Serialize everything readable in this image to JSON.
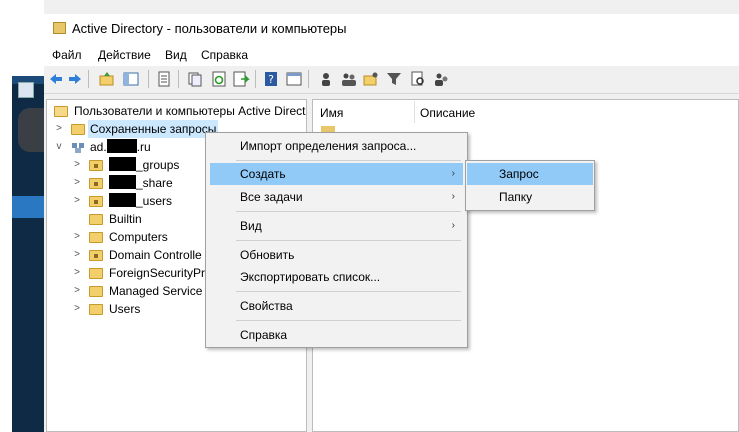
{
  "window": {
    "title": "Active Directory - пользователи и компьютеры",
    "menu": [
      "Файл",
      "Действие",
      "Вид",
      "Справка"
    ]
  },
  "toolbar": {
    "icons": [
      "back-arrow-icon",
      "forward-arrow-icon",
      "up-folder-icon",
      "console-tree-icon",
      "properties-sheet-icon",
      "copy-icon",
      "refresh-icon",
      "export-list-icon",
      "help-icon",
      "mmc-console-icon",
      "users-icon",
      "groups-icon",
      "ou-icon",
      "filter-icon",
      "find-icon",
      "add-to-group-icon"
    ]
  },
  "tree": {
    "root": "Пользователи и компьютеры Active Direct",
    "saved_queries": "Сохраненные запросы",
    "domain_prefix": "ad.",
    "domain_suffix": ".ru",
    "items": [
      {
        "label": "_groups",
        "redacted": true
      },
      {
        "label": "_share",
        "redacted": true
      },
      {
        "label": "_users",
        "redacted": true
      },
      {
        "label": "Builtin"
      },
      {
        "label": "Computers"
      },
      {
        "label": "Domain Controlle"
      },
      {
        "label": "ForeignSecurityPr"
      },
      {
        "label": "Managed Service A"
      },
      {
        "label": "Users"
      }
    ]
  },
  "list": {
    "col_name": "Имя",
    "col_desc": "Описание"
  },
  "context_menu": {
    "items": [
      {
        "label": "Импорт определения запроса..."
      },
      {
        "label": "Создать",
        "arrow": "›",
        "highlighted": true
      },
      {
        "label": "Все задачи",
        "arrow": "›"
      },
      {
        "label": "Вид",
        "arrow": "›"
      },
      {
        "label": "Обновить"
      },
      {
        "label": "Экспортировать список..."
      },
      {
        "label": "Свойства"
      },
      {
        "label": "Справка"
      }
    ]
  },
  "submenu": {
    "items": [
      {
        "label": "Запрос",
        "highlighted": true
      },
      {
        "label": "Папку"
      }
    ]
  },
  "colors": {
    "highlight": "#91c9f7",
    "selection": "#cce8ff",
    "folder": "#f3cf6b"
  }
}
